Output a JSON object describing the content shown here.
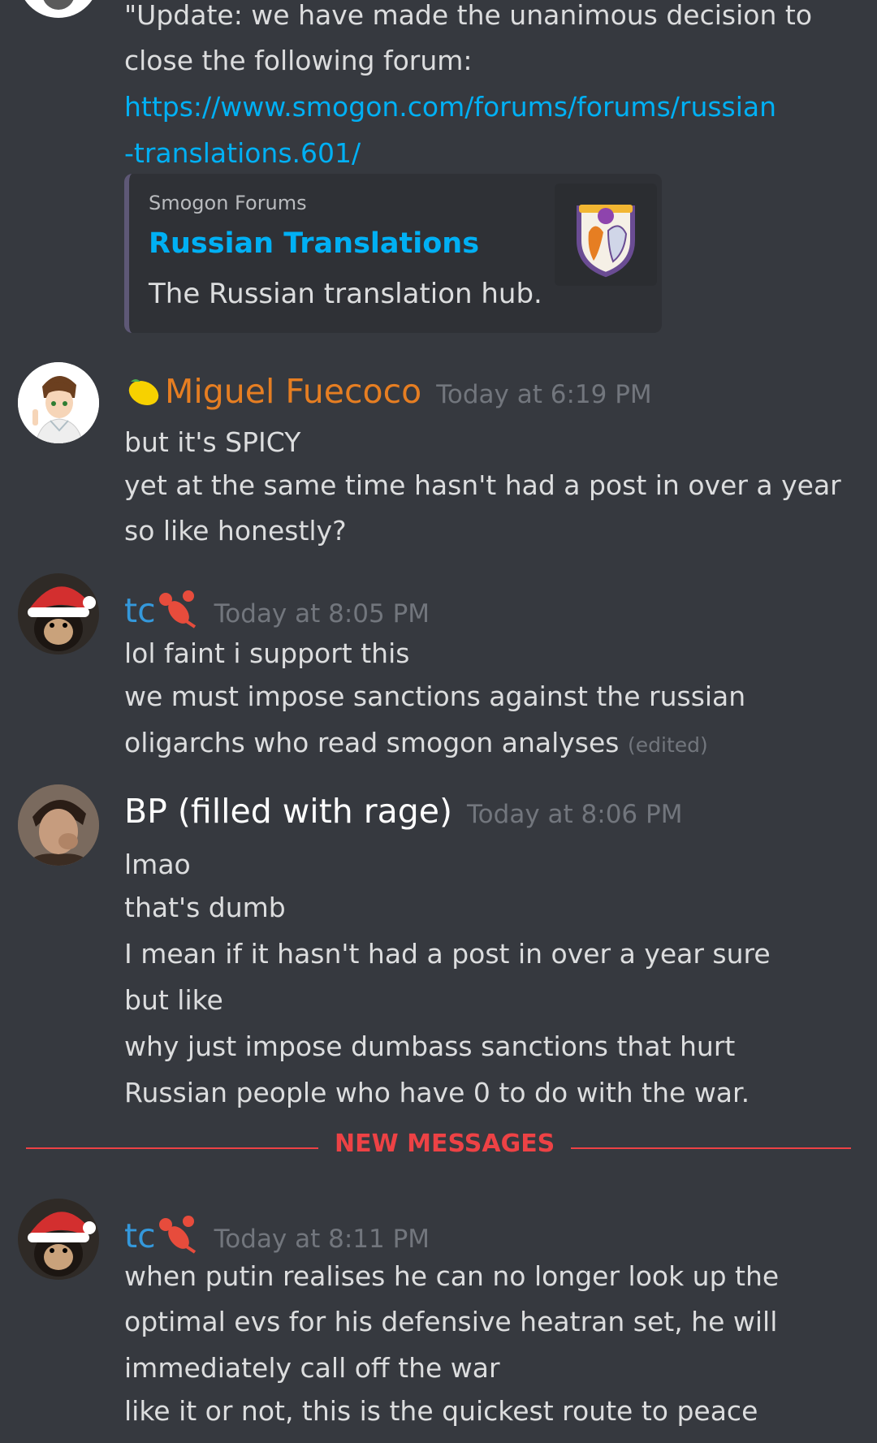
{
  "first_message": {
    "lines": [
      "\"Update: we have made the unanimous decision to",
      "close the following forum:"
    ],
    "link_line_1": "https://www.smogon.com/forums/forums/russian",
    "link_line_2": "-translations.601/",
    "embed": {
      "provider": "Smogon Forums",
      "title": "Russian Translations",
      "description": "The Russian translation hub."
    }
  },
  "messages": [
    {
      "username": "Miguel Fuecoco",
      "username_color": "#e67e22",
      "emoji": "lemon-emoji",
      "timestamp": "Today at 6:19 PM",
      "lines": [
        "but it's SPICY",
        "yet at the same time hasn't had a post in over a year",
        "so like honestly?"
      ]
    },
    {
      "username": "tc",
      "username_color": "#3498db",
      "emoji": "lobster-emoji",
      "timestamp": "Today at 8:05 PM",
      "lines": [
        "lol faint i support this",
        "we must impose sanctions against the russian",
        "oligarchs who read smogon analyses"
      ],
      "edited": "(edited)"
    },
    {
      "username": "BP (filled with rage)",
      "username_color": "#ffffff",
      "timestamp": "Today at 8:06 PM",
      "lines": [
        "lmao",
        "that's dumb",
        "I mean if it hasn't had a post in over a year sure",
        "but like",
        "why just impose dumbass sanctions that hurt",
        "Russian people who have 0 to do with the war."
      ]
    },
    {
      "username": "tc",
      "username_color": "#3498db",
      "emoji": "lobster-emoji",
      "timestamp": "Today at 8:11 PM",
      "lines": [
        "when putin realises he can no longer look up the",
        "optimal evs for his defensive heatran set, he will",
        "immediately call off the war",
        "like it or not, this is the quickest route to peace"
      ]
    }
  ],
  "new_messages_divider": "NEW MESSAGES",
  "colors": {
    "background": "#36393f",
    "link": "#00b0f4",
    "timestamp": "#72767d",
    "divider": "#ed4245"
  }
}
